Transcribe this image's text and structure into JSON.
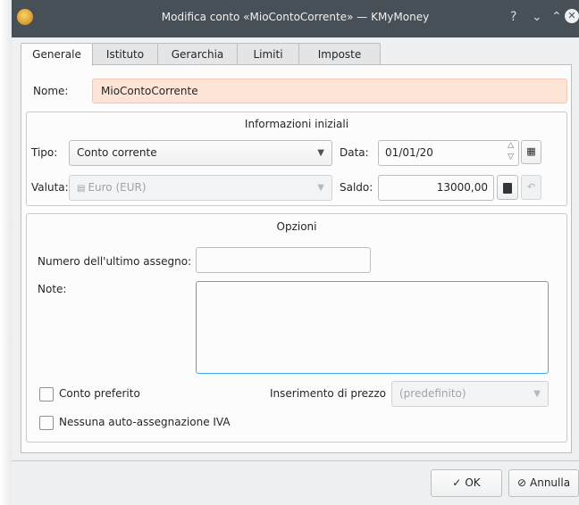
{
  "window": {
    "title": "Modifica conto «MioContoCorrente» — KMyMoney",
    "help_glyph": "?",
    "minimize_glyph": "⌄",
    "maximize_glyph": "⌃",
    "close_glyph": "✕"
  },
  "tabs": [
    {
      "label": "Generale",
      "active": true
    },
    {
      "label": "Istituto",
      "active": false
    },
    {
      "label": "Gerarchia",
      "active": false
    },
    {
      "label": "Limiti",
      "active": false
    },
    {
      "label": "Imposte",
      "active": false
    }
  ],
  "name": {
    "label": "Nome:",
    "value": "MioContoCorrente"
  },
  "initial_info": {
    "title": "Informazioni iniziali",
    "type_label": "Tipo:",
    "type_value": "Conto corrente",
    "date_label": "Data:",
    "date_value": "01/01/20",
    "currency_label": "Valuta:",
    "currency_value": "Euro (EUR)",
    "balance_label": "Saldo:",
    "balance_value": "13000,00"
  },
  "options": {
    "title": "Opzioni",
    "last_check_label": "Numero dell'ultimo assegno:",
    "last_check_value": "",
    "notes_label": "Note:",
    "notes_value": "",
    "favorite_label": "Conto preferito",
    "favorite_checked": false,
    "no_vat_label": "Nessuna auto-assegnazione IVA",
    "no_vat_checked": false,
    "price_entry_label": "Inserimento di prezzo",
    "price_entry_value": "(predefinito)"
  },
  "buttons": {
    "ok_label": "OK",
    "cancel_label": "Annulla"
  },
  "icons": {
    "ok": "check-icon",
    "cancel": "cancel-icon",
    "calendar": "calendar-icon",
    "calculator": "calculator-icon",
    "reset": "undo-icon",
    "currency": "currency-icon"
  },
  "colors": {
    "titlebar": "#475057",
    "name_field_bg": "#fde4d7",
    "window_bg": "#eff0f1",
    "focus_border": "#3daee9"
  }
}
